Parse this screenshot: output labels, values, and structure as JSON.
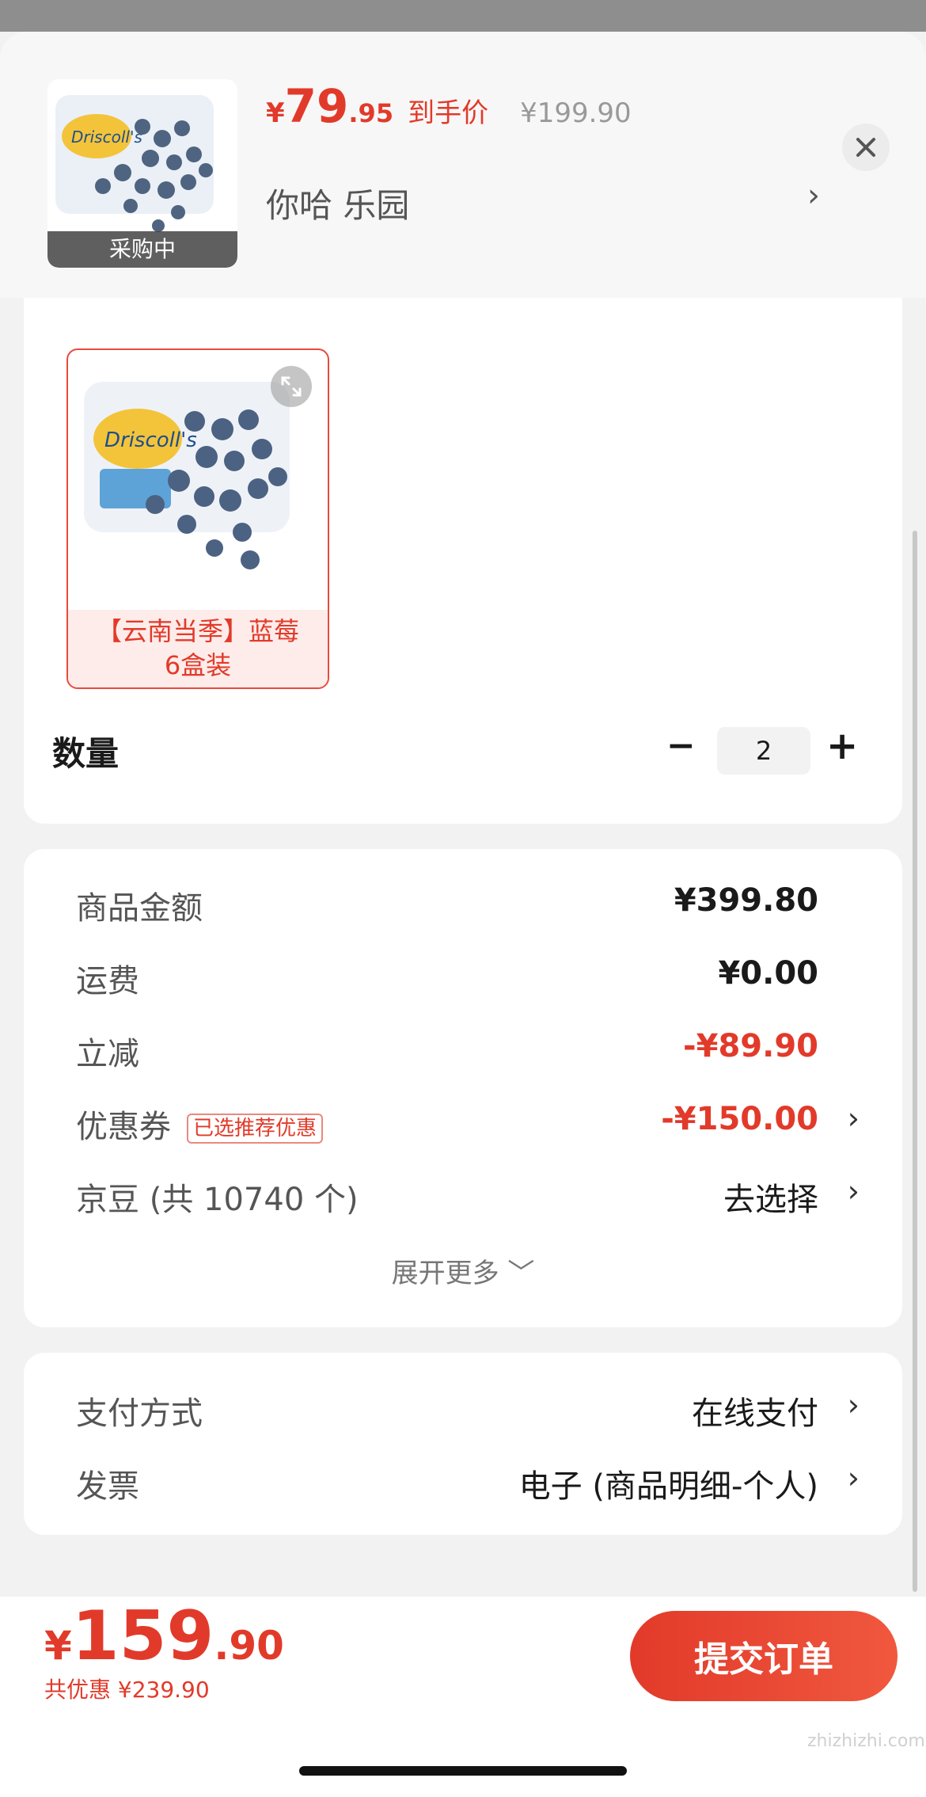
{
  "header": {
    "thumb_badge": "采购中",
    "price_currency": "¥",
    "price_int": "79",
    "price_dec": ".95",
    "price_tag": "到手价",
    "orig_price": "¥199.90",
    "variant": "你哈  乐园",
    "variant_arrow": "›",
    "close_icon": "close-icon"
  },
  "sku_section": {
    "selected_sku": "【云南当季】蓝莓\n6盒装"
  },
  "quantity": {
    "label": "数量",
    "minus": "−",
    "value": "2",
    "plus": "+"
  },
  "summary": {
    "rows": [
      {
        "label": "商品金额",
        "value": "¥399.80"
      },
      {
        "label": "运费",
        "value": "¥0.00"
      },
      {
        "label": "立减",
        "value": "-¥89.90"
      },
      {
        "label": "优惠券",
        "tag": "已选推荐优惠",
        "value": "-¥150.00",
        "arrow": "›"
      },
      {
        "label": "京豆 (共 10740 个)",
        "value": "去选择",
        "arrow": "›"
      }
    ],
    "expand_more": "展开更多 ﹀"
  },
  "payment": {
    "rows": [
      {
        "label": "支付方式",
        "value": "在线支付",
        "arrow": "›"
      },
      {
        "label": "发票",
        "value": "电子 (商品明细-个人)",
        "arrow": "›"
      }
    ]
  },
  "footer": {
    "currency": "¥",
    "total_int": "159",
    "total_dec": ".90",
    "saved": "共优惠 ¥239.90",
    "submit": "提交订单",
    "watermark": "zhizhizhi.com"
  },
  "colors": {
    "accent": "#e23a2a",
    "background": "#f2f2f2"
  }
}
